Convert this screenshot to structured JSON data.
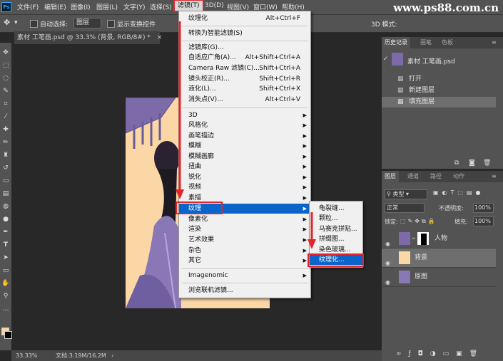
{
  "app_logo": "Ps",
  "menubar": [
    "文件(F)",
    "编辑(E)",
    "图像(I)",
    "图层(L)",
    "文字(Y)",
    "选择(S)",
    "滤镜(T)",
    "3D(D)",
    "视图(V)",
    "窗口(W)",
    "帮助(H)"
  ],
  "watermark": "www.ps88.com.cn",
  "options": {
    "auto_select_label": "自动选择:",
    "auto_select_value": "图层",
    "show_transform_label": "显示变换控件",
    "mode_3d_label": "3D 模式:"
  },
  "document_tab": "素材 工笔画.psd @ 33.3% (背景, RGB/8#) *",
  "status": {
    "zoom": "33.33%",
    "doc": "文档:3.19M/16.2M"
  },
  "filter_menu": {
    "top": [
      {
        "label": "纹理化",
        "shortcut": "Alt+Ctrl+F"
      }
    ],
    "convert": "转换为智能滤镜(S)",
    "gallery": [
      {
        "label": "滤镜库(G)...",
        "shortcut": ""
      },
      {
        "label": "自适应广角(A)...",
        "shortcut": "Alt+Shift+Ctrl+A"
      },
      {
        "label": "Camera Raw 滤镜(C)...",
        "shortcut": "Shift+Ctrl+A"
      },
      {
        "label": "镜头校正(R)...",
        "shortcut": "Shift+Ctrl+R"
      },
      {
        "label": "液化(L)...",
        "shortcut": "Shift+Ctrl+X"
      },
      {
        "label": "消失点(V)...",
        "shortcut": "Alt+Ctrl+V"
      }
    ],
    "submenus": [
      "3D",
      "风格化",
      "画笔描边",
      "模糊",
      "模糊画廊",
      "扭曲",
      "锐化",
      "视频",
      "素描",
      "纹理",
      "像素化",
      "渲染",
      "艺术效果",
      "杂色",
      "其它"
    ],
    "plugin": "Imagenomic",
    "browse": "浏览联机滤镜..."
  },
  "texture_submenu": [
    "龟裂缝...",
    "颗粒...",
    "马赛克拼贴...",
    "拼缀图...",
    "染色玻璃...",
    "纹理化..."
  ],
  "history_panel": {
    "tabs": [
      "历史记录",
      "画笔",
      "色板"
    ],
    "snapshot": "素材 工笔画.psd",
    "items": [
      "打开",
      "新建图层",
      "填充图层"
    ]
  },
  "layers_panel": {
    "tabs": [
      "图层",
      "通道",
      "路径",
      "动作"
    ],
    "filter_kind": "类型",
    "blend_mode": "正常",
    "opacity_label": "不透明度:",
    "opacity_value": "100%",
    "lock_label": "锁定:",
    "fill_label": "填充:",
    "fill_value": "100%",
    "layers": [
      "人物",
      "背景",
      "原图"
    ]
  },
  "colors": {
    "highlight": "#0a64c9",
    "annotation_red": "#e0262a",
    "canvas_bg": "#fbd7a6"
  }
}
